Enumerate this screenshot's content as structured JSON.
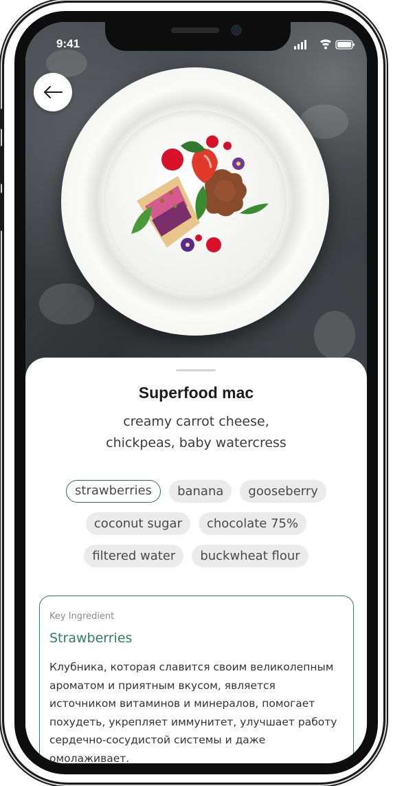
{
  "status_bar": {
    "time": "9:41"
  },
  "back_button": {
    "icon": "arrow-left-icon"
  },
  "dish": {
    "title": "Superfood mac",
    "subtitle_line1": "creamy carrot cheese,",
    "subtitle_line2": "chickpeas, baby watercress"
  },
  "ingredients": [
    {
      "label": "strawberries",
      "selected": true
    },
    {
      "label": "banana",
      "selected": false
    },
    {
      "label": "gooseberry",
      "selected": false
    },
    {
      "label": "coconut sugar",
      "selected": false
    },
    {
      "label": "chocolate 75%",
      "selected": false
    },
    {
      "label": "filtered water",
      "selected": false
    },
    {
      "label": "buckwheat flour",
      "selected": false
    }
  ],
  "key_ingredient": {
    "label": "Key Ingredient",
    "name": "Strawberries",
    "description": "Клубника, которая славится своим великолепным ароматом и приятным вкусом, является источником витаминов и минералов, помогает похудеть, укрепляет иммунитет, улучшает работу сердечно-сосудистой системы и даже омолаживает."
  },
  "colors": {
    "accent": "#2e7d65",
    "tag_bg": "#ebebeb",
    "text_dark": "#1c1c1c"
  }
}
